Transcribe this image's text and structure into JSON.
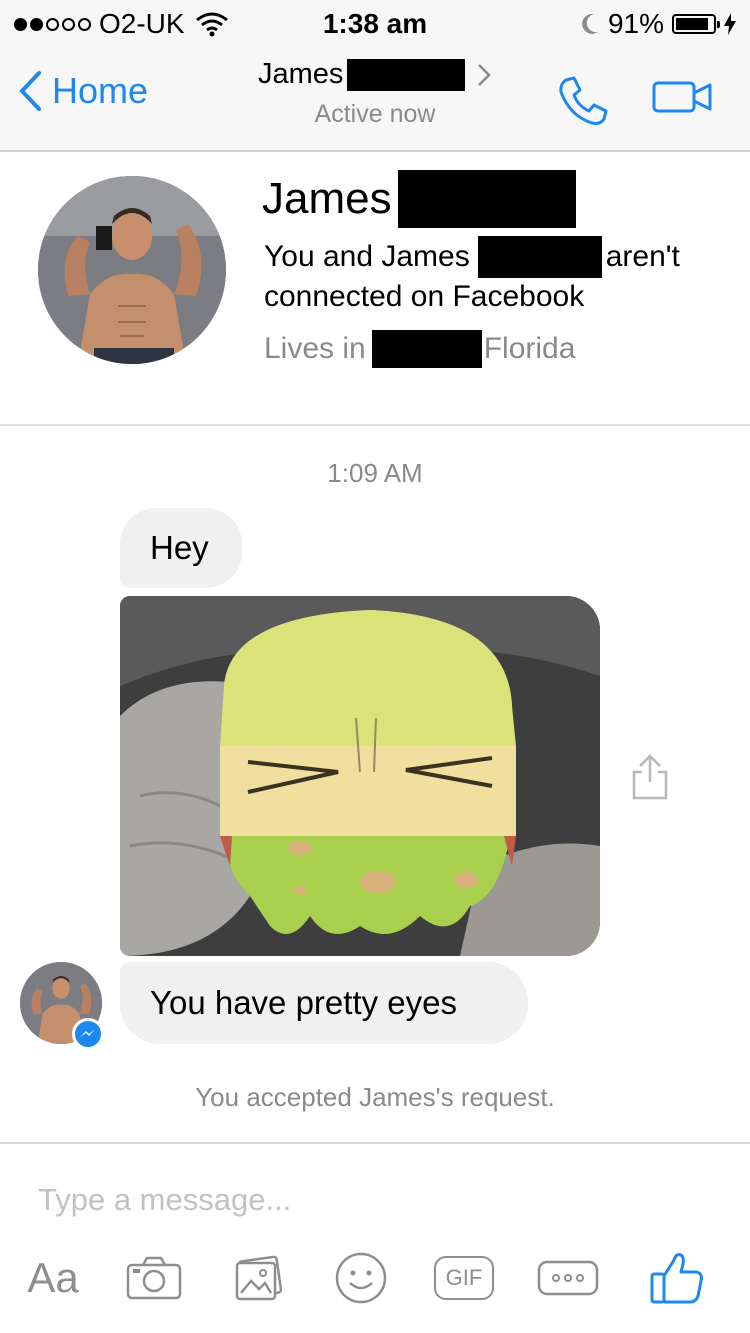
{
  "status_bar": {
    "carrier": "O2-UK",
    "time": "1:38 am",
    "battery_percent": "91%",
    "battery_level": 0.91
  },
  "nav": {
    "back_label": "Home",
    "title": "James",
    "subtitle": "Active now"
  },
  "profile": {
    "name": "James",
    "connection_text_1": "You and James",
    "connection_text_2": "aren't",
    "connection_text_3": "connected on Facebook",
    "lives_in_label": "Lives in",
    "location_suffix": "Florida"
  },
  "conversation": {
    "timestamp": "1:09 AM",
    "messages": [
      {
        "text": "Hey"
      },
      {
        "text": "You have pretty eyes"
      }
    ],
    "notice": "You accepted James's request."
  },
  "composer": {
    "placeholder": "Type a message...",
    "text_tool_label": "Aa",
    "gif_label": "GIF"
  },
  "colors": {
    "accent": "#1e87f0",
    "bubble": "#f0f0f0",
    "secondary_text": "#8a8a8a"
  }
}
